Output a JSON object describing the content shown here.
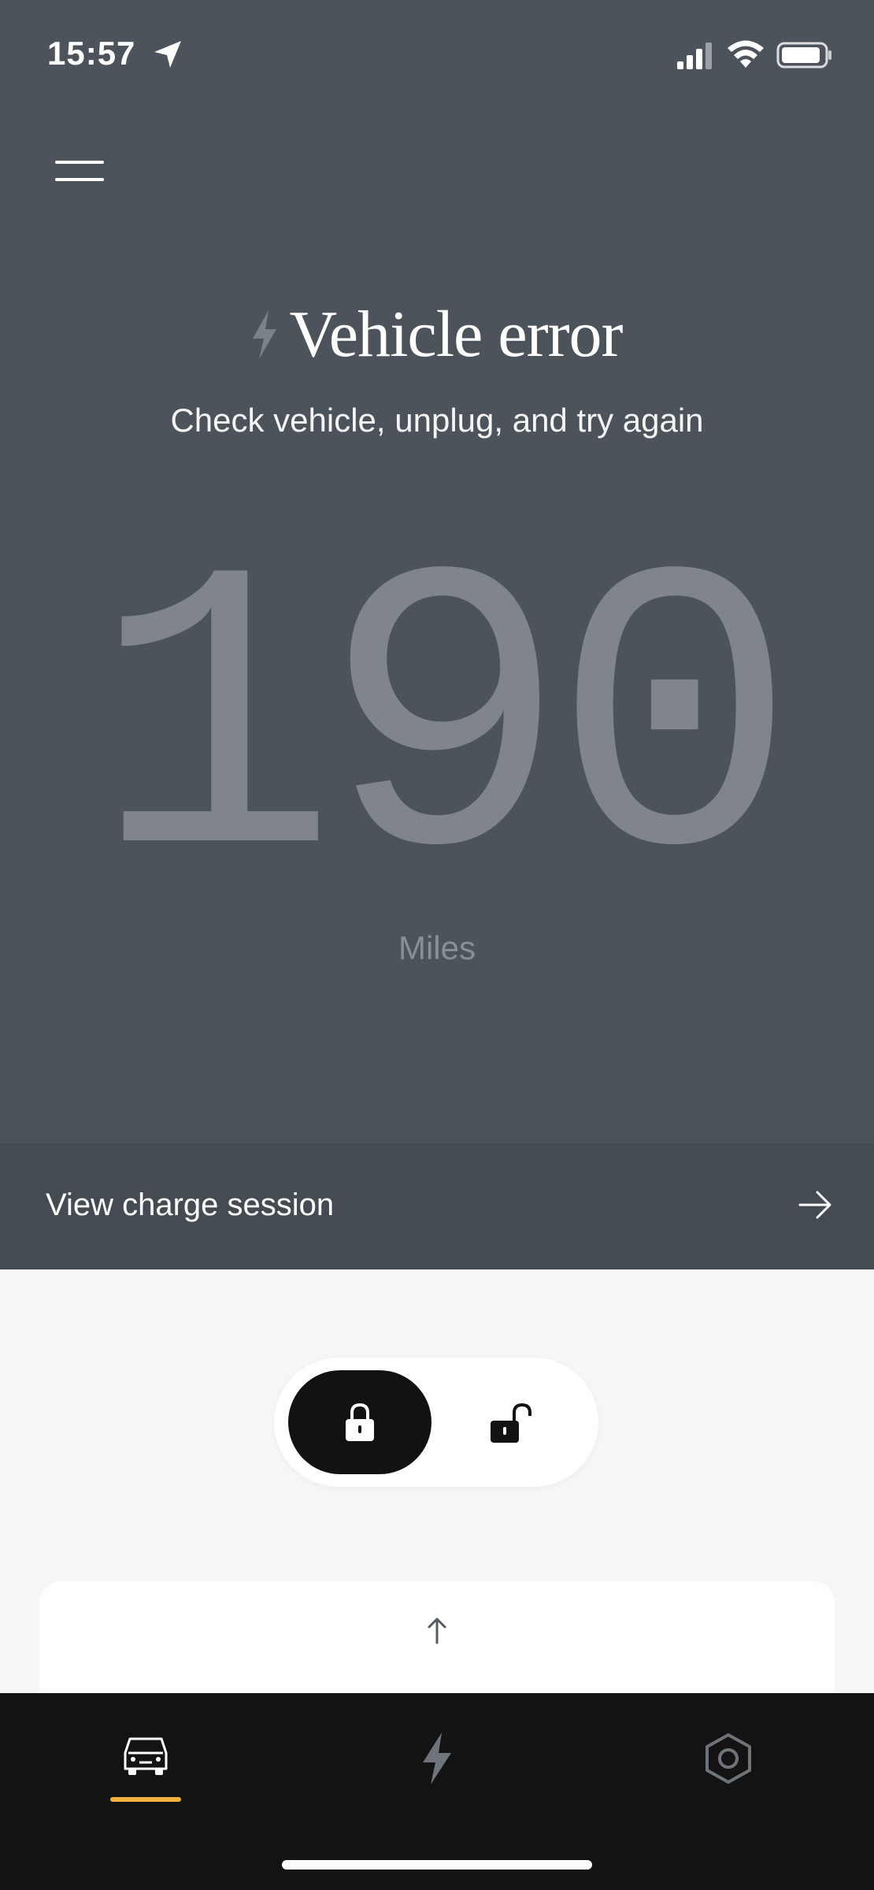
{
  "status_bar": {
    "time": "15:57"
  },
  "hero": {
    "status_title": "Vehicle error",
    "status_subtitle": "Check vehicle, unplug, and try again",
    "range_value": "190",
    "range_unit": "Miles"
  },
  "charge_session": {
    "label": "View charge session"
  },
  "lock_control": {
    "selected": "locked"
  },
  "tabs": [
    {
      "icon": "car-icon",
      "active": true
    },
    {
      "icon": "lightning-bolt-icon",
      "active": false
    },
    {
      "icon": "hexagon-settings-icon",
      "active": false
    }
  ],
  "colors": {
    "hero_background": "#4c535b",
    "charge_row_background": "#454b52",
    "range_text": "#80858b",
    "active_tab_accent": "#f2b23c",
    "tabbar_background": "#131313"
  }
}
